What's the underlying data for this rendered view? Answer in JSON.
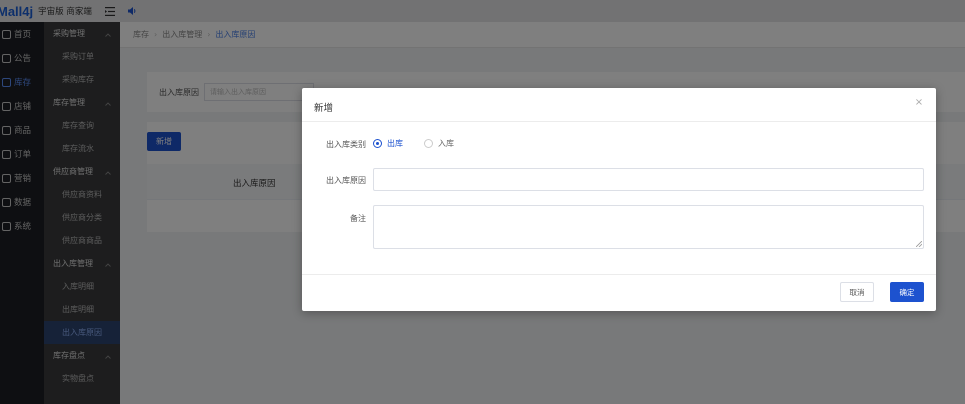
{
  "topbar": {
    "logo": "Mall4j",
    "brand": "宇宙版 商家端",
    "menu_icon": "menu-fold-icon",
    "sound_icon": "speaker-icon"
  },
  "nav": {
    "items": [
      {
        "label": "首页",
        "icon": "home-icon",
        "active": false
      },
      {
        "label": "公告",
        "icon": "notice-icon",
        "active": false
      },
      {
        "label": "库存",
        "icon": "inventory-icon",
        "active": true
      },
      {
        "label": "店铺",
        "icon": "shop-icon",
        "active": false
      },
      {
        "label": "商品",
        "icon": "product-icon",
        "active": false
      },
      {
        "label": "订单",
        "icon": "order-icon",
        "active": false
      },
      {
        "label": "营销",
        "icon": "marketing-icon",
        "active": false
      },
      {
        "label": "数据",
        "icon": "data-icon",
        "active": false
      },
      {
        "label": "系统",
        "icon": "settings-icon",
        "active": false
      }
    ]
  },
  "subnav": {
    "entries": [
      {
        "type": "group",
        "label": "采购管理"
      },
      {
        "type": "item",
        "label": "采购订单"
      },
      {
        "type": "item",
        "label": "采购库存"
      },
      {
        "type": "group",
        "label": "库存管理"
      },
      {
        "type": "item",
        "label": "库存查询"
      },
      {
        "type": "item",
        "label": "库存流水"
      },
      {
        "type": "group",
        "label": "供应商管理"
      },
      {
        "type": "item",
        "label": "供应商资料"
      },
      {
        "type": "item",
        "label": "供应商分类"
      },
      {
        "type": "item",
        "label": "供应商商品"
      },
      {
        "type": "group",
        "label": "出入库管理"
      },
      {
        "type": "item",
        "label": "入库明细"
      },
      {
        "type": "item",
        "label": "出库明细"
      },
      {
        "type": "item",
        "label": "出入库原因",
        "active": true
      },
      {
        "type": "group",
        "label": "库存盘点"
      },
      {
        "type": "item",
        "label": "实物盘点"
      }
    ]
  },
  "breadcrumb": {
    "items": [
      "库存",
      "出入库管理",
      "出入库原因"
    ]
  },
  "search": {
    "label": "出入库原因",
    "placeholder": "请输入出入库原因"
  },
  "table": {
    "add_label": "新增",
    "col_reason": "出入库原因"
  },
  "dialog": {
    "title": "新增",
    "type_label": "出入库类别",
    "options": [
      {
        "label": "出库",
        "checked": true
      },
      {
        "label": "入库",
        "checked": false
      }
    ],
    "reason_label": "出入库原因",
    "reason_value": "",
    "remark_label": "备注",
    "remark_value": "",
    "cancel_label": "取消",
    "ok_label": "确定"
  },
  "colors": {
    "primary": "#1d52cf",
    "nav_bg": "#1d1f24",
    "subnav_bg": "#3a3b3d",
    "active_sub_bg": "#2d4470"
  }
}
